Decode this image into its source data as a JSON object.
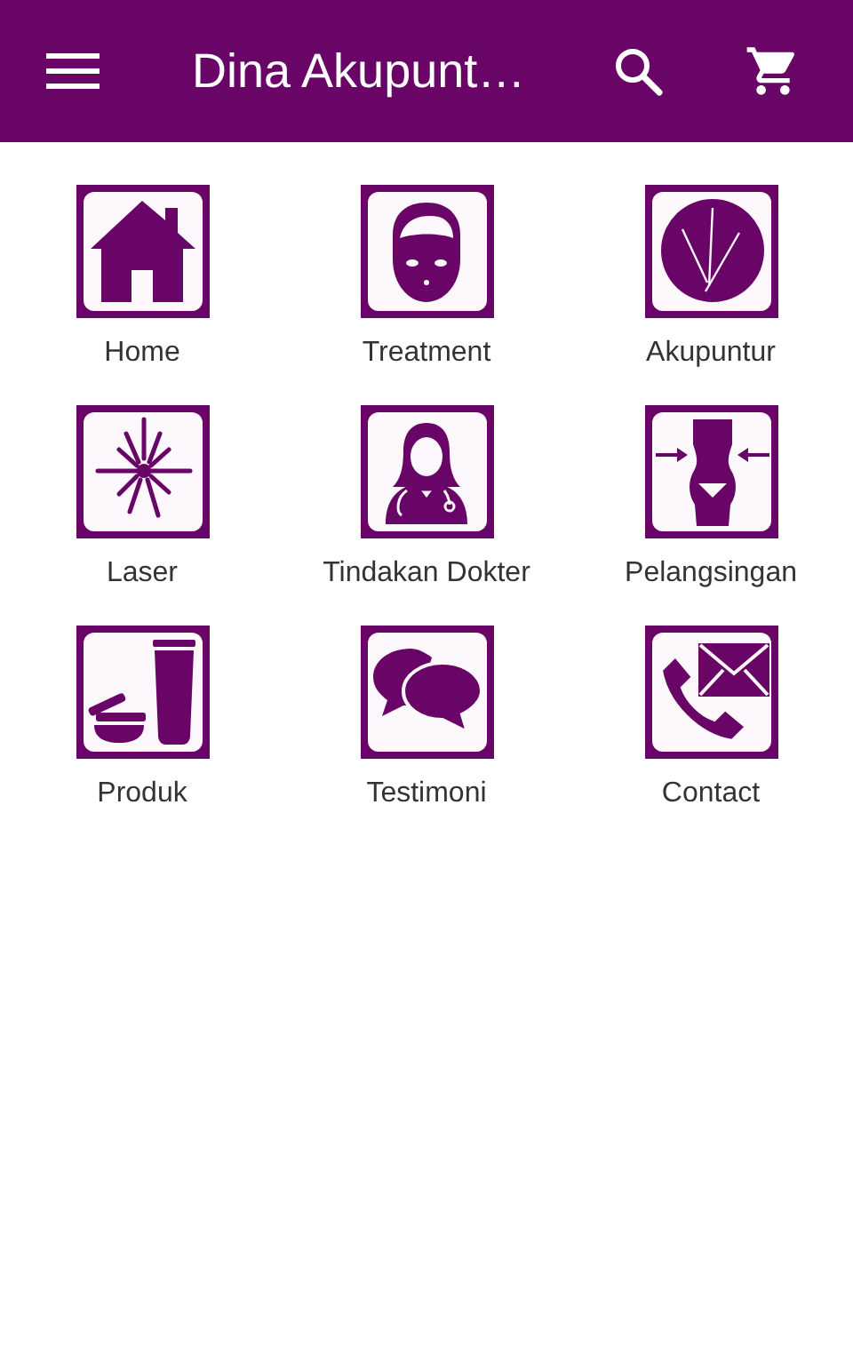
{
  "app_bar": {
    "title": "Dina Akupunt…"
  },
  "menu": [
    {
      "label": "Home",
      "kind": "home"
    },
    {
      "label": "Treatment",
      "kind": "face"
    },
    {
      "label": "Akupuntur",
      "kind": "needles"
    },
    {
      "label": "Laser",
      "kind": "laser"
    },
    {
      "label": "Tindakan Dokter",
      "kind": "doctor"
    },
    {
      "label": "Pelangsingan",
      "kind": "slimming"
    },
    {
      "label": "Produk",
      "kind": "product"
    },
    {
      "label": "Testimoni",
      "kind": "chat"
    },
    {
      "label": "Contact",
      "kind": "contact"
    }
  ]
}
